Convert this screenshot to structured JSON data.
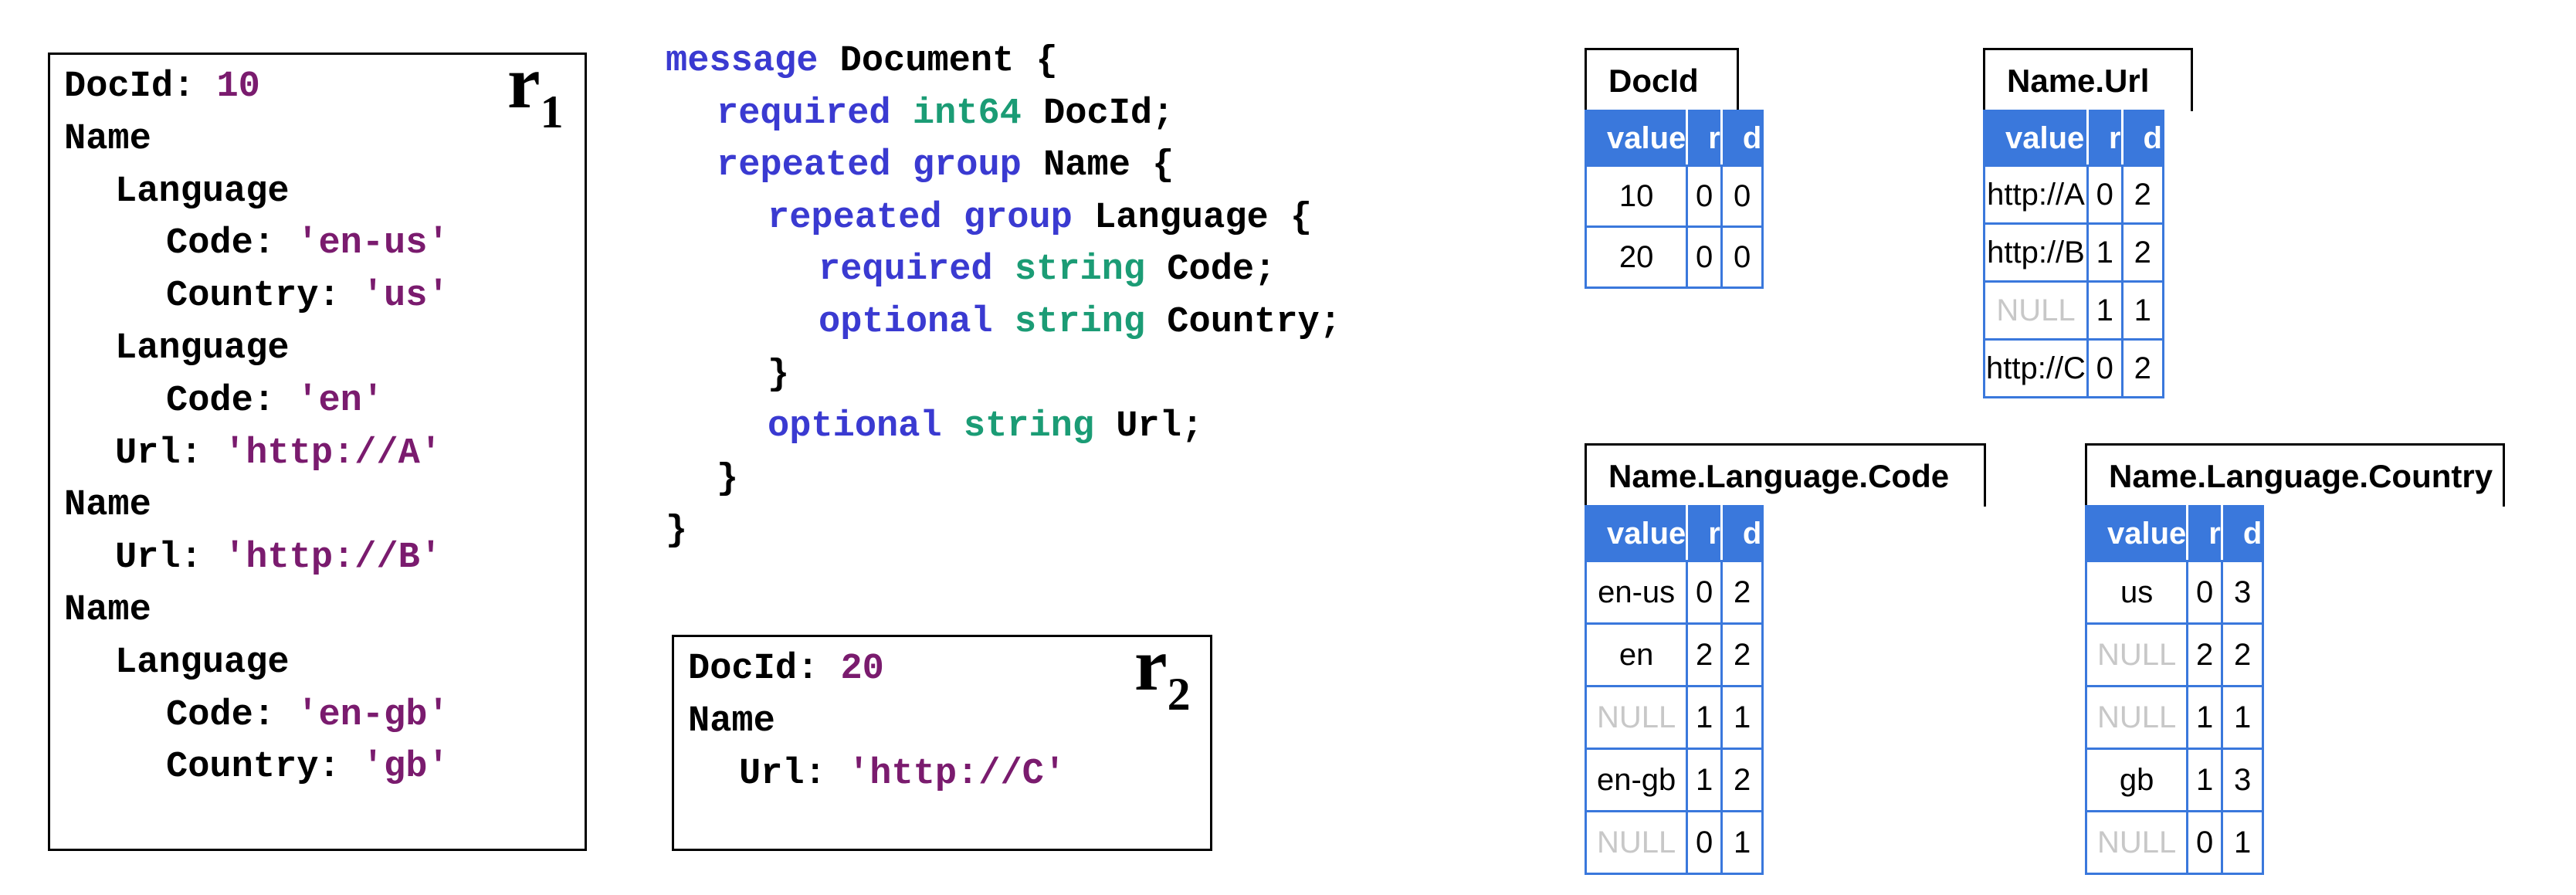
{
  "r1": {
    "label": "r",
    "subscript": "1",
    "lines": [
      {
        "key": "DocId",
        "value": "10",
        "indent": 0,
        "vtype": "num"
      },
      {
        "key": "Name",
        "value": null,
        "indent": 0
      },
      {
        "key": "Language",
        "value": null,
        "indent": 1
      },
      {
        "key": "Code",
        "value": "'en-us'",
        "indent": 2,
        "vtype": "str"
      },
      {
        "key": "Country",
        "value": "'us'",
        "indent": 2,
        "vtype": "str"
      },
      {
        "key": "Language",
        "value": null,
        "indent": 1
      },
      {
        "key": "Code",
        "value": "'en'",
        "indent": 2,
        "vtype": "str"
      },
      {
        "key": "Url",
        "value": "'http://A'",
        "indent": 1,
        "vtype": "str"
      },
      {
        "key": "Name",
        "value": null,
        "indent": 0
      },
      {
        "key": "Url",
        "value": "'http://B'",
        "indent": 1,
        "vtype": "str"
      },
      {
        "key": "Name",
        "value": null,
        "indent": 0
      },
      {
        "key": "Language",
        "value": null,
        "indent": 1
      },
      {
        "key": "Code",
        "value": "'en-gb'",
        "indent": 2,
        "vtype": "str"
      },
      {
        "key": "Country",
        "value": "'gb'",
        "indent": 2,
        "vtype": "str"
      }
    ]
  },
  "r2": {
    "label": "r",
    "subscript": "2",
    "lines": [
      {
        "key": "DocId",
        "value": "20",
        "indent": 0,
        "vtype": "num"
      },
      {
        "key": "Name",
        "value": null,
        "indent": 0
      },
      {
        "key": "Url",
        "value": "'http://C'",
        "indent": 1,
        "vtype": "str"
      }
    ]
  },
  "schema": {
    "lines": [
      {
        "indent": 0,
        "tokens": [
          {
            "t": "message",
            "c": "kw"
          },
          {
            "t": " Document {",
            "c": ""
          }
        ]
      },
      {
        "indent": 1,
        "tokens": [
          {
            "t": "required",
            "c": "kw"
          },
          {
            "t": " ",
            "c": ""
          },
          {
            "t": "int64",
            "c": "ty"
          },
          {
            "t": " DocId;",
            "c": ""
          }
        ]
      },
      {
        "indent": 1,
        "tokens": [
          {
            "t": "repeated",
            "c": "kw"
          },
          {
            "t": " ",
            "c": ""
          },
          {
            "t": "group",
            "c": "kw"
          },
          {
            "t": " Name {",
            "c": ""
          }
        ]
      },
      {
        "indent": 2,
        "tokens": [
          {
            "t": "repeated",
            "c": "kw"
          },
          {
            "t": " ",
            "c": ""
          },
          {
            "t": "group",
            "c": "kw"
          },
          {
            "t": " Language {",
            "c": ""
          }
        ]
      },
      {
        "indent": 3,
        "tokens": [
          {
            "t": "required",
            "c": "kw"
          },
          {
            "t": " ",
            "c": ""
          },
          {
            "t": "string",
            "c": "ty"
          },
          {
            "t": " Code;",
            "c": ""
          }
        ]
      },
      {
        "indent": 3,
        "tokens": [
          {
            "t": "optional",
            "c": "kw"
          },
          {
            "t": " ",
            "c": ""
          },
          {
            "t": "string",
            "c": "ty"
          },
          {
            "t": " Country;",
            "c": ""
          }
        ]
      },
      {
        "indent": 2,
        "tokens": [
          {
            "t": "}",
            "c": ""
          }
        ]
      },
      {
        "indent": 2,
        "tokens": [
          {
            "t": "optional",
            "c": "kw"
          },
          {
            "t": " ",
            "c": ""
          },
          {
            "t": "string",
            "c": "ty"
          },
          {
            "t": " Url;",
            "c": ""
          }
        ]
      },
      {
        "indent": 1,
        "tokens": [
          {
            "t": "}",
            "c": ""
          }
        ]
      },
      {
        "indent": 0,
        "tokens": [
          {
            "t": "}",
            "c": ""
          }
        ]
      }
    ]
  },
  "columns": {
    "headers": [
      "value",
      "r",
      "d"
    ],
    "docid": {
      "title": "DocId",
      "rows": [
        [
          "10",
          "0",
          "0"
        ],
        [
          "20",
          "0",
          "0"
        ]
      ]
    },
    "name_url": {
      "title": "Name.Url",
      "rows": [
        [
          "http://A",
          "0",
          "2"
        ],
        [
          "http://B",
          "1",
          "2"
        ],
        [
          "NULL",
          "1",
          "1"
        ],
        [
          "http://C",
          "0",
          "2"
        ]
      ]
    },
    "name_language_code": {
      "title": "Name.Language.Code",
      "rows": [
        [
          "en-us",
          "0",
          "2"
        ],
        [
          "en",
          "2",
          "2"
        ],
        [
          "NULL",
          "1",
          "1"
        ],
        [
          "en-gb",
          "1",
          "2"
        ],
        [
          "NULL",
          "0",
          "1"
        ]
      ]
    },
    "name_language_country": {
      "title": "Name.Language.Country",
      "rows": [
        [
          "us",
          "0",
          "3"
        ],
        [
          "NULL",
          "2",
          "2"
        ],
        [
          "NULL",
          "1",
          "1"
        ],
        [
          "gb",
          "1",
          "3"
        ],
        [
          "NULL",
          "0",
          "1"
        ]
      ]
    }
  },
  "colors": {
    "keyword": "#3a3ad1",
    "type": "#1b9c75",
    "literal": "#7a1b6e",
    "table_header": "#3a78dc",
    "null_text": "#c8c8c8"
  }
}
